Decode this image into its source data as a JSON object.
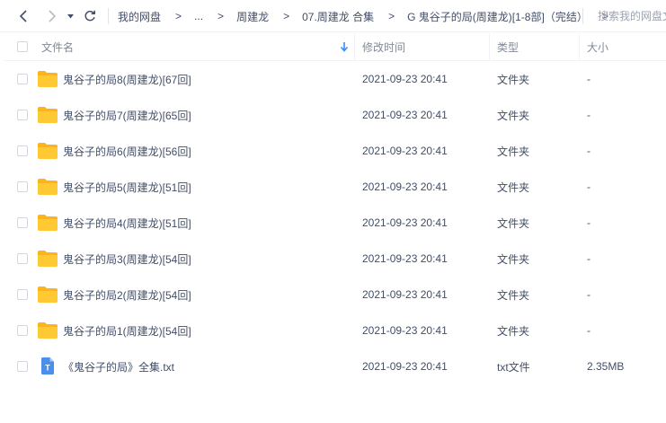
{
  "toolbar": {
    "breadcrumbs": [
      "我的网盘",
      "...",
      "周建龙",
      "07.周建龙 合集",
      "G 鬼谷子的局(周建龙)[1-8部]（完结）"
    ],
    "separator": ">",
    "search_placeholder": "搜索我的网盘文件"
  },
  "columns": {
    "name": "文件名",
    "modified": "修改时间",
    "type": "类型",
    "size": "大小"
  },
  "colors": {
    "folder": "#ffc933",
    "folder_back": "#ffb319",
    "txt_icon": "#4b8fea",
    "sort_arrow": "#3a8cf2"
  },
  "rows": [
    {
      "icon": "folder-icon",
      "name": "鬼谷子的局8(周建龙)[67回]",
      "modified": "2021-09-23 20:41",
      "type": "文件夹",
      "size": "-"
    },
    {
      "icon": "folder-icon",
      "name": "鬼谷子的局7(周建龙)[65回]",
      "modified": "2021-09-23 20:41",
      "type": "文件夹",
      "size": "-"
    },
    {
      "icon": "folder-icon",
      "name": "鬼谷子的局6(周建龙)[56回]",
      "modified": "2021-09-23 20:41",
      "type": "文件夹",
      "size": "-"
    },
    {
      "icon": "folder-icon",
      "name": "鬼谷子的局5(周建龙)[51回]",
      "modified": "2021-09-23 20:41",
      "type": "文件夹",
      "size": "-"
    },
    {
      "icon": "folder-icon",
      "name": "鬼谷子的局4(周建龙)[51回]",
      "modified": "2021-09-23 20:41",
      "type": "文件夹",
      "size": "-"
    },
    {
      "icon": "folder-icon",
      "name": "鬼谷子的局3(周建龙)[54回]",
      "modified": "2021-09-23 20:41",
      "type": "文件夹",
      "size": "-"
    },
    {
      "icon": "folder-icon",
      "name": "鬼谷子的局2(周建龙)[54回]",
      "modified": "2021-09-23 20:41",
      "type": "文件夹",
      "size": "-"
    },
    {
      "icon": "folder-icon",
      "name": "鬼谷子的局1(周建龙)[54回]",
      "modified": "2021-09-23 20:41",
      "type": "文件夹",
      "size": "-"
    },
    {
      "icon": "txt-file-icon",
      "icon_letter": "T",
      "name": "《鬼谷子的局》全集.txt",
      "modified": "2021-09-23 20:41",
      "type": "txt文件",
      "size": "2.35MB"
    }
  ]
}
